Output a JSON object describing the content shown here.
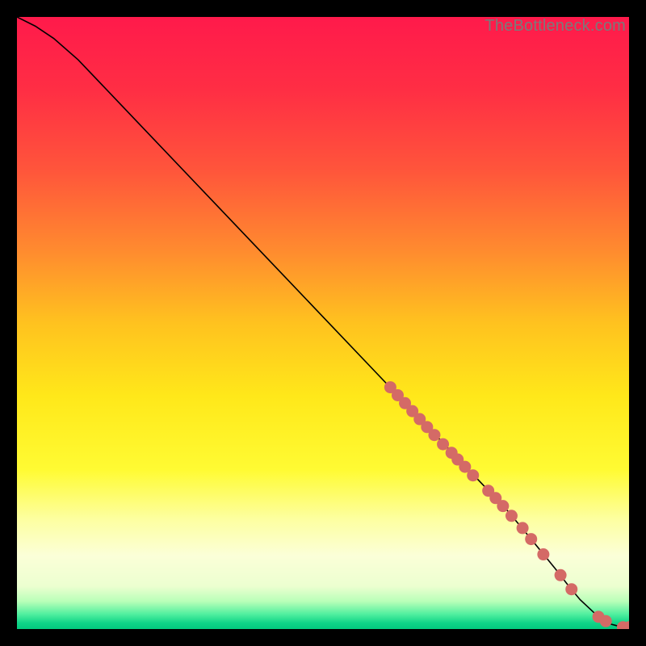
{
  "watermark": "TheBottleneck.com",
  "colors": {
    "curve": "#000000",
    "marker": "#d46a66",
    "gradient_stops": [
      {
        "offset": 0.0,
        "color": "#ff1a4b"
      },
      {
        "offset": 0.12,
        "color": "#ff2e44"
      },
      {
        "offset": 0.25,
        "color": "#ff553b"
      },
      {
        "offset": 0.38,
        "color": "#ff8a2f"
      },
      {
        "offset": 0.5,
        "color": "#ffc21f"
      },
      {
        "offset": 0.62,
        "color": "#ffe81a"
      },
      {
        "offset": 0.74,
        "color": "#fffb33"
      },
      {
        "offset": 0.82,
        "color": "#fdffa0"
      },
      {
        "offset": 0.88,
        "color": "#fbffd8"
      },
      {
        "offset": 0.93,
        "color": "#ecffd0"
      },
      {
        "offset": 0.955,
        "color": "#b8ffb8"
      },
      {
        "offset": 0.975,
        "color": "#54f0a0"
      },
      {
        "offset": 0.99,
        "color": "#10d488"
      },
      {
        "offset": 1.0,
        "color": "#03c97e"
      }
    ]
  },
  "chart_data": {
    "type": "line",
    "title": "",
    "xlabel": "",
    "ylabel": "",
    "xlim": [
      0,
      100
    ],
    "ylim": [
      0,
      100
    ],
    "series": [
      {
        "name": "bottleneck-curve",
        "x": [
          0,
          3,
          6,
          10,
          20,
          30,
          40,
          50,
          60,
          70,
          80,
          84,
          88,
          90,
          92,
          95,
          97,
          99,
          100
        ],
        "y": [
          100,
          98.5,
          96.5,
          93,
          82.5,
          72,
          61.5,
          51,
          40.5,
          30,
          19.5,
          14.7,
          9.8,
          7.2,
          4.8,
          2.0,
          0.8,
          0.3,
          0.3
        ]
      }
    ],
    "markers": {
      "name": "highlighted-points",
      "x": [
        61.0,
        62.2,
        63.4,
        64.6,
        65.8,
        67.0,
        68.2,
        69.6,
        71.0,
        72.0,
        73.2,
        74.5,
        77.0,
        78.2,
        79.4,
        80.8,
        82.6,
        84.0,
        86.0,
        88.8,
        90.6,
        95.0,
        96.2,
        99.0,
        100.0
      ],
      "y": [
        39.5,
        38.2,
        36.9,
        35.6,
        34.3,
        33.0,
        31.7,
        30.2,
        28.8,
        27.7,
        26.5,
        25.1,
        22.6,
        21.4,
        20.1,
        18.5,
        16.5,
        14.7,
        12.2,
        8.8,
        6.5,
        2.0,
        1.3,
        0.3,
        0.3
      ]
    }
  }
}
